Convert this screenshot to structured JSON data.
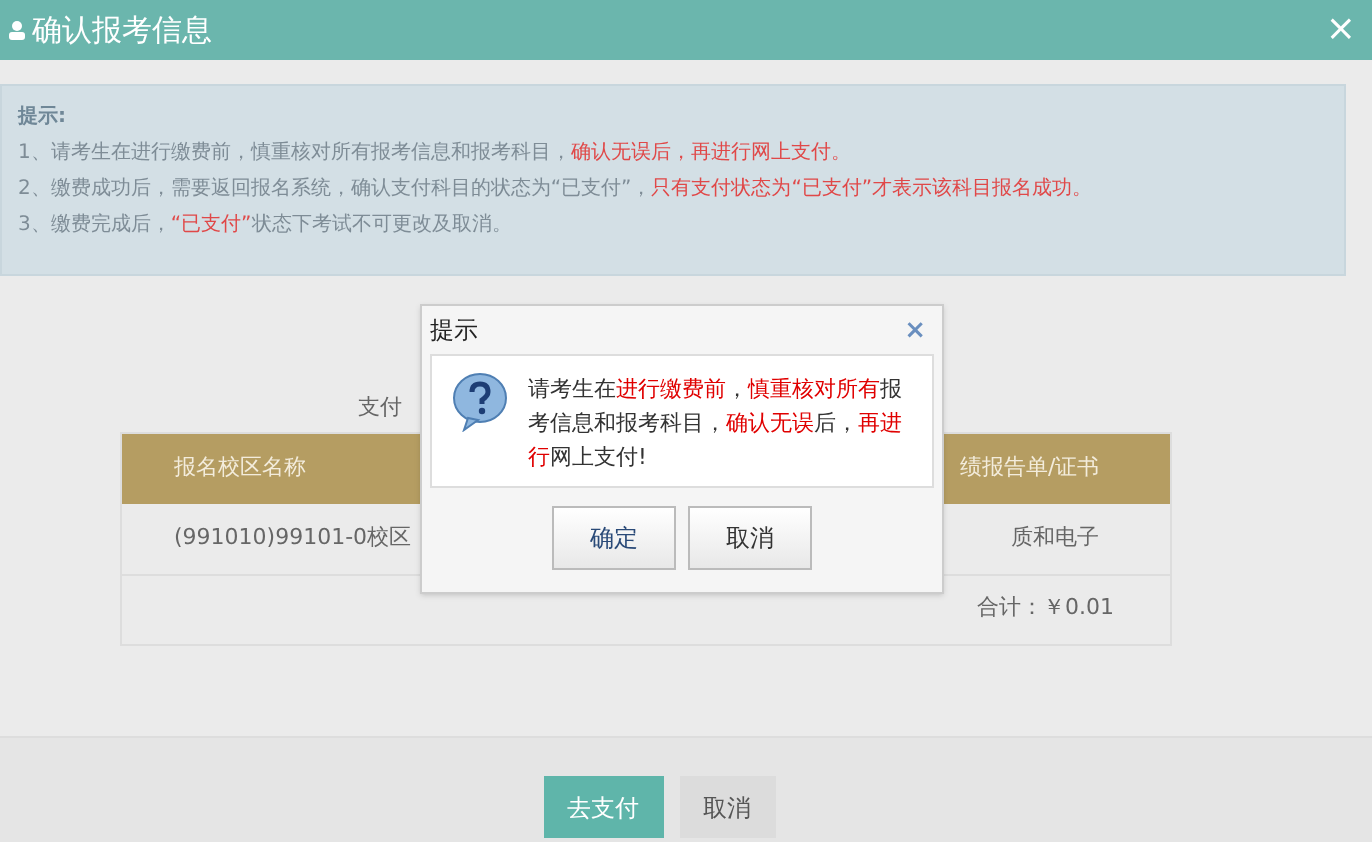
{
  "window": {
    "title": "确认报考信息",
    "close": "×"
  },
  "notice": {
    "title": "提示:",
    "lines": [
      [
        {
          "text": "1、请考生在进行缴费前，慎重核对所有报考信息和报考科目，",
          "red": false
        },
        {
          "text": "确认无误后，再进行网上支付。",
          "red": true
        }
      ],
      [
        {
          "text": "2、缴费成功后，需要返回报名系统，确认支付科目的状态为“已支付”，",
          "red": false
        },
        {
          "text": "只有支付状态为“已支付”才表示该科目报名成功。",
          "red": true
        }
      ],
      [
        {
          "text": "3、缴费完成后，",
          "red": false
        },
        {
          "text": "“已支付”",
          "red": true
        },
        {
          "text": "状态下考试不可更改及取消。",
          "red": false
        }
      ]
    ]
  },
  "partial_label": "支付",
  "table": {
    "columns": [
      "报名校区名称",
      "绩报告单/证书"
    ],
    "rows": [
      [
        "(991010)99101-0校区",
        "质和电子"
      ]
    ],
    "total": "合计：￥0.01"
  },
  "buttons": [
    {
      "label": "去支付",
      "kind": "primary"
    },
    {
      "label": "取消",
      "kind": "secondary"
    }
  ],
  "dialog": {
    "title": "提示",
    "close": "×",
    "message": [
      {
        "text": "请考生在",
        "red": false
      },
      {
        "text": "进行缴费前",
        "red": true
      },
      {
        "text": "，",
        "red": false
      },
      {
        "text": "慎重核对所有",
        "red": true
      },
      {
        "text": "报考信息和报考科目，",
        "red": false
      },
      {
        "text": "确认无误",
        "red": true
      },
      {
        "text": "后，",
        "red": false
      },
      {
        "text": "再进行",
        "red": true
      },
      {
        "text": "网上支付!",
        "red": false
      }
    ],
    "buttons": [
      "确定",
      "取消"
    ]
  }
}
